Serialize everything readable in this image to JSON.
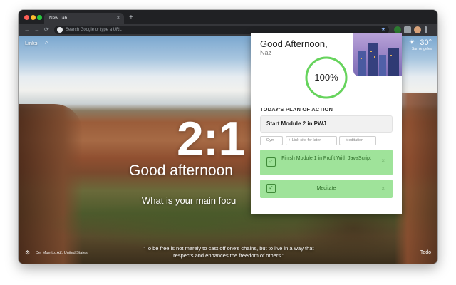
{
  "browser": {
    "tab_title": "New Tab",
    "tab_close": "×",
    "new_tab": "+",
    "omnibox_placeholder": "Search Google or type a URL",
    "nav_back": "←",
    "nav_forward": "→",
    "nav_reload": "⟳",
    "bookmark_star": "★"
  },
  "page": {
    "links_label": "Links",
    "clock": "2:1",
    "greeting": "Good afternoon",
    "focus_question": "What is your main focu",
    "location": "Del Muerto, AZ, United States",
    "quote": "\"To be free is not merely to cast off one's chains, but to live in a way that respects and enhances the freedom of others.\"",
    "todo_label": "Todo",
    "weather": {
      "temp": "30°",
      "location": "San Angeles",
      "icon": "sun-icon"
    }
  },
  "popup": {
    "greeting": "Good Afternoon,",
    "name": "Naz",
    "progress_text": "100%",
    "progress_value": 1.0,
    "plan_title": "TODAY'S PLAN OF ACTION",
    "plan_input_value": "Start Module 2 in PWJ",
    "suggestions": [
      "+ Gym",
      "+ Link site for later",
      "+ Meditation"
    ],
    "tasks": [
      {
        "label": "Finish Module 1 in Profit With JavaScript",
        "done": true
      },
      {
        "label": "Meditate",
        "done": true
      }
    ],
    "check_glyph": "✓",
    "remove_glyph": "×"
  },
  "colors": {
    "progress_ring": "#66d45c",
    "task_bg": "#9fe39a",
    "task_text": "#2f6e2a"
  }
}
